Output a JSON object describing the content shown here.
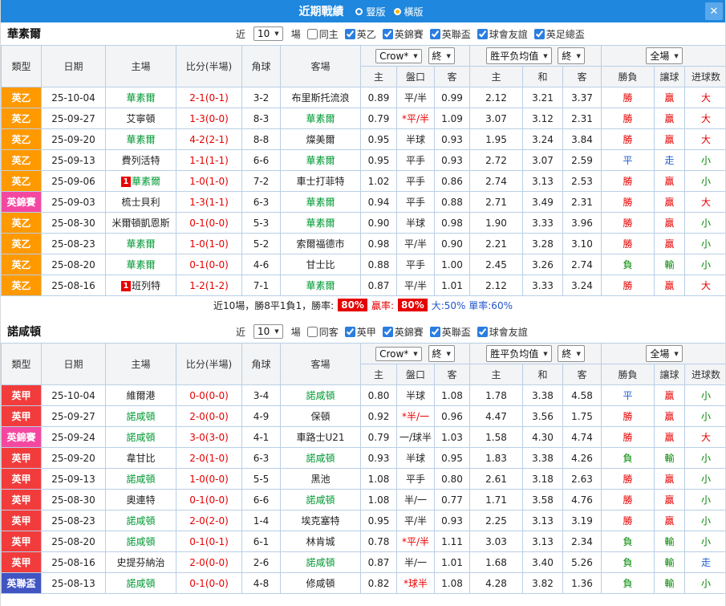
{
  "titlebar": {
    "title": "近期戰績",
    "vertical_label": "豎版",
    "horizontal_label": "橫版",
    "close_glyph": "✕"
  },
  "columns": {
    "type": "類型",
    "date": "日期",
    "home": "主場",
    "score": "比分(半場)",
    "corners": "角球",
    "away": "客場",
    "odds_provider": "Crow*",
    "final": "終",
    "avg": "胜平负均值",
    "fulltime": "全場",
    "home_odds": "主",
    "handicap": "盤口",
    "away_odds": "客",
    "avg_home": "主",
    "avg_draw": "和",
    "avg_away": "客",
    "wdl": "勝負",
    "let_ball": "讓球",
    "goals": "进球数"
  },
  "colors": {
    "titlebar": "#1f87dd",
    "league": {
      "英乙": "#ff9900",
      "英錦賽": "#f448a0",
      "英甲": "#f23c3c",
      "英聯盃": "#4055c2"
    },
    "focus_team": "#009933",
    "score": "#e60000",
    "result": {
      "勝": "#e60000",
      "平": "#1f5fd0",
      "負": "#008800",
      "贏": "#e60000",
      "走": "#1f5fd0",
      "輸": "#008800",
      "大": "#e60000",
      "小": "#008800"
    },
    "rate_badge": "#e60000",
    "tail_text": "#2255cc"
  },
  "section1": {
    "team": "華素爾",
    "filters": {
      "near_label": "近",
      "count": "10",
      "games_label": "場",
      "checkboxes": [
        {
          "label": "同主",
          "checked": false
        },
        {
          "label": "英乙",
          "checked": true
        },
        {
          "label": "英錦賽",
          "checked": true
        },
        {
          "label": "英聯盃",
          "checked": true
        },
        {
          "label": "球會友誼",
          "checked": true
        },
        {
          "label": "英足總盃",
          "checked": true
        }
      ]
    },
    "rows": [
      {
        "type": "英乙",
        "date": "25-10-04",
        "home": "華素爾",
        "score": "2-1(0-1)",
        "corners": "3-2",
        "away": "布里斯托流浪",
        "odds": [
          "0.89",
          "平/半",
          "0.99"
        ],
        "avg": [
          "2.12",
          "3.21",
          "3.37"
        ],
        "res": [
          "勝",
          "贏",
          "大"
        ]
      },
      {
        "type": "英乙",
        "date": "25-09-27",
        "home": "艾寧頓",
        "score": "1-3(0-0)",
        "corners": "8-3",
        "away": "華素爾",
        "odds": [
          "0.79",
          "*平/半",
          "1.09"
        ],
        "avg": [
          "3.07",
          "3.12",
          "2.31"
        ],
        "res": [
          "勝",
          "贏",
          "大"
        ]
      },
      {
        "type": "英乙",
        "date": "25-09-20",
        "home": "華素爾",
        "score": "4-2(2-1)",
        "corners": "8-8",
        "away": "燦美爾",
        "odds": [
          "0.95",
          "半球",
          "0.93"
        ],
        "avg": [
          "1.95",
          "3.24",
          "3.84"
        ],
        "res": [
          "勝",
          "贏",
          "大"
        ]
      },
      {
        "type": "英乙",
        "date": "25-09-13",
        "home": "費列活特",
        "score": "1-1(1-1)",
        "corners": "6-6",
        "away": "華素爾",
        "odds": [
          "0.95",
          "平手",
          "0.93"
        ],
        "avg": [
          "2.72",
          "3.07",
          "2.59"
        ],
        "res": [
          "平",
          "走",
          "小"
        ]
      },
      {
        "type": "英乙",
        "date": "25-09-06",
        "home": "華素爾",
        "home_badge": "1",
        "score": "1-0(1-0)",
        "corners": "7-2",
        "away": "車士打菲特",
        "odds": [
          "1.02",
          "平手",
          "0.86"
        ],
        "avg": [
          "2.74",
          "3.13",
          "2.53"
        ],
        "res": [
          "勝",
          "贏",
          "小"
        ]
      },
      {
        "type": "英錦賽",
        "date": "25-09-03",
        "home": "梳士貝利",
        "score": "1-3(1-1)",
        "corners": "6-3",
        "away": "華素爾",
        "odds": [
          "0.94",
          "平手",
          "0.88"
        ],
        "avg": [
          "2.71",
          "3.49",
          "2.31"
        ],
        "res": [
          "勝",
          "贏",
          "大"
        ]
      },
      {
        "type": "英乙",
        "date": "25-08-30",
        "home": "米爾頓凱恩斯",
        "score": "0-1(0-0)",
        "corners": "5-3",
        "away": "華素爾",
        "odds": [
          "0.90",
          "半球",
          "0.98"
        ],
        "avg": [
          "1.90",
          "3.33",
          "3.96"
        ],
        "res": [
          "勝",
          "贏",
          "小"
        ]
      },
      {
        "type": "英乙",
        "date": "25-08-23",
        "home": "華素爾",
        "score": "1-0(1-0)",
        "corners": "5-2",
        "away": "索爾福德市",
        "odds": [
          "0.98",
          "平/半",
          "0.90"
        ],
        "avg": [
          "2.21",
          "3.28",
          "3.10"
        ],
        "res": [
          "勝",
          "贏",
          "小"
        ]
      },
      {
        "type": "英乙",
        "date": "25-08-20",
        "home": "華素爾",
        "score": "0-1(0-0)",
        "corners": "4-6",
        "away": "甘士比",
        "odds": [
          "0.88",
          "平手",
          "1.00"
        ],
        "avg": [
          "2.45",
          "3.26",
          "2.74"
        ],
        "res": [
          "負",
          "輸",
          "小"
        ]
      },
      {
        "type": "英乙",
        "date": "25-08-16",
        "home": "班列特",
        "home_badge": "1",
        "score": "1-2(1-2)",
        "corners": "7-1",
        "away": "華素爾",
        "odds": [
          "0.87",
          "平/半",
          "1.01"
        ],
        "avg": [
          "2.12",
          "3.33",
          "3.24"
        ],
        "res": [
          "勝",
          "贏",
          "大"
        ]
      }
    ],
    "summary": {
      "lead": "近10場，勝8平1負1，勝率:",
      "win_rate": "80%",
      "mid": "贏率:",
      "profit_rate": "80%",
      "tail": "大:50% 單率:60%"
    }
  },
  "section2": {
    "team": "諾咸頓",
    "filters": {
      "near_label": "近",
      "count": "10",
      "games_label": "場",
      "checkboxes": [
        {
          "label": "同客",
          "checked": false
        },
        {
          "label": "英甲",
          "checked": true
        },
        {
          "label": "英錦賽",
          "checked": true
        },
        {
          "label": "英聯盃",
          "checked": true
        },
        {
          "label": "球會友誼",
          "checked": true
        }
      ]
    },
    "rows": [
      {
        "type": "英甲",
        "date": "25-10-04",
        "home": "維爾港",
        "score": "0-0(0-0)",
        "corners": "3-4",
        "away": "諾咸頓",
        "odds": [
          "0.80",
          "半球",
          "1.08"
        ],
        "avg": [
          "1.78",
          "3.38",
          "4.58"
        ],
        "res": [
          "平",
          "贏",
          "小"
        ]
      },
      {
        "type": "英甲",
        "date": "25-09-27",
        "home": "諾咸頓",
        "score": "2-0(0-0)",
        "corners": "4-9",
        "away": "保頓",
        "odds": [
          "0.92",
          "*半/一",
          "0.96"
        ],
        "avg": [
          "4.47",
          "3.56",
          "1.75"
        ],
        "res": [
          "勝",
          "贏",
          "小"
        ]
      },
      {
        "type": "英錦賽",
        "date": "25-09-24",
        "home": "諾咸頓",
        "score": "3-0(3-0)",
        "corners": "4-1",
        "away": "車路士U21",
        "odds": [
          "0.79",
          "一/球半",
          "1.03"
        ],
        "avg": [
          "1.58",
          "4.30",
          "4.74"
        ],
        "res": [
          "勝",
          "贏",
          "大"
        ]
      },
      {
        "type": "英甲",
        "date": "25-09-20",
        "home": "韋甘比",
        "score": "2-0(1-0)",
        "corners": "6-3",
        "away": "諾咸頓",
        "odds": [
          "0.93",
          "半球",
          "0.95"
        ],
        "avg": [
          "1.83",
          "3.38",
          "4.26"
        ],
        "res": [
          "負",
          "輸",
          "小"
        ]
      },
      {
        "type": "英甲",
        "date": "25-09-13",
        "home": "諾咸頓",
        "score": "1-0(0-0)",
        "corners": "5-5",
        "away": "黑池",
        "odds": [
          "1.08",
          "平手",
          "0.80"
        ],
        "avg": [
          "2.61",
          "3.18",
          "2.63"
        ],
        "res": [
          "勝",
          "贏",
          "小"
        ]
      },
      {
        "type": "英甲",
        "date": "25-08-30",
        "home": "奧連特",
        "score": "0-1(0-0)",
        "corners": "6-6",
        "away": "諾咸頓",
        "odds": [
          "1.08",
          "半/一",
          "0.77"
        ],
        "avg": [
          "1.71",
          "3.58",
          "4.76"
        ],
        "res": [
          "勝",
          "贏",
          "小"
        ]
      },
      {
        "type": "英甲",
        "date": "25-08-23",
        "home": "諾咸頓",
        "score": "2-0(2-0)",
        "corners": "1-4",
        "away": "埃克塞特",
        "odds": [
          "0.95",
          "平/半",
          "0.93"
        ],
        "avg": [
          "2.25",
          "3.13",
          "3.19"
        ],
        "res": [
          "勝",
          "贏",
          "小"
        ]
      },
      {
        "type": "英甲",
        "date": "25-08-20",
        "home": "諾咸頓",
        "score": "0-1(0-1)",
        "corners": "6-1",
        "away": "林肯城",
        "odds": [
          "0.78",
          "*平/半",
          "1.11"
        ],
        "avg": [
          "3.03",
          "3.13",
          "2.34"
        ],
        "res": [
          "負",
          "輸",
          "小"
        ]
      },
      {
        "type": "英甲",
        "date": "25-08-16",
        "home": "史提芬納治",
        "score": "2-0(0-0)",
        "corners": "2-6",
        "away": "諾咸頓",
        "odds": [
          "0.87",
          "半/一",
          "1.01"
        ],
        "avg": [
          "1.68",
          "3.40",
          "5.26"
        ],
        "res": [
          "負",
          "輸",
          "走"
        ]
      },
      {
        "type": "英聯盃",
        "date": "25-08-13",
        "home": "諾咸頓",
        "score": "0-1(0-0)",
        "corners": "4-8",
        "away": "修咸頓",
        "odds": [
          "0.82",
          "*球半",
          "1.08"
        ],
        "avg": [
          "4.28",
          "3.82",
          "1.36"
        ],
        "res": [
          "負",
          "輸",
          "小"
        ]
      }
    ]
  }
}
